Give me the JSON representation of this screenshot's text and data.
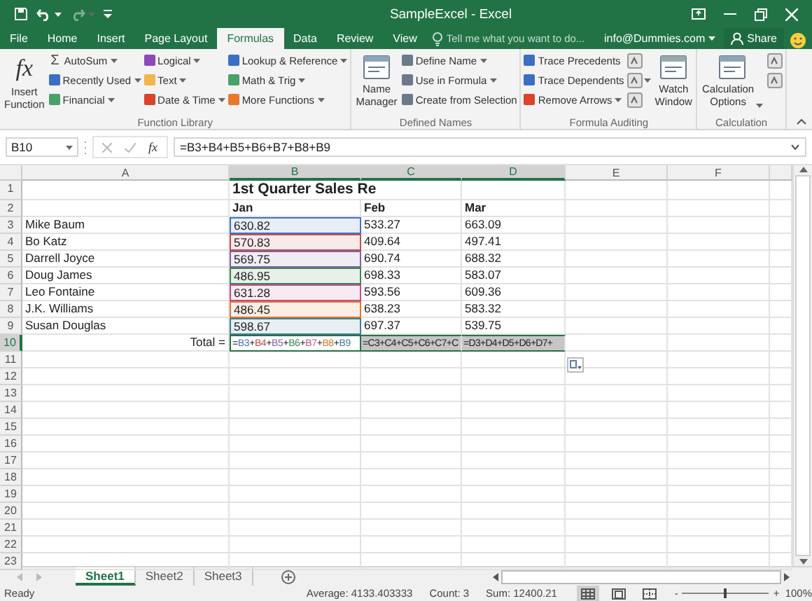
{
  "title_bar": {
    "title": "SampleExcel - Excel",
    "quick_access": [
      {
        "kind": "save",
        "disabled": false
      },
      {
        "kind": "undo",
        "disabled": false
      },
      {
        "kind": "redo",
        "disabled": true
      },
      {
        "kind": "customize",
        "disabled": false
      }
    ]
  },
  "ribbon_tabs": [
    {
      "label": "File",
      "selected": false
    },
    {
      "label": "Home",
      "selected": false
    },
    {
      "label": "Insert",
      "selected": false
    },
    {
      "label": "Page Layout",
      "selected": false
    },
    {
      "label": "Formulas",
      "selected": true
    },
    {
      "label": "Data",
      "selected": false
    },
    {
      "label": "Review",
      "selected": false
    },
    {
      "label": "View",
      "selected": false
    }
  ],
  "tell_me": {
    "placeholder": "Tell me what you want to do..."
  },
  "account": "info@Dummies.com",
  "share": "Share",
  "ribbon_groups": [
    {
      "label": "Function Library",
      "items": [
        {
          "kind": "large",
          "label": "Insert Function",
          "symbol": "fx",
          "dropdown": false
        },
        {
          "kind": "small",
          "label": "AutoSum",
          "symbol": "Σ",
          "dropdown": true
        },
        {
          "kind": "small",
          "label": "Recently Used",
          "color": "#3b6fc4",
          "dropdown": true
        },
        {
          "kind": "small",
          "label": "Financial",
          "color": "#4aa06a",
          "dropdown": true
        },
        {
          "kind": "small",
          "label": "Logical",
          "color": "#8a4bb8",
          "dropdown": true
        },
        {
          "kind": "small",
          "label": "Text",
          "color": "#f0b84a",
          "dropdown": true
        },
        {
          "kind": "small",
          "label": "Date & Time",
          "color": "#d9442a",
          "dropdown": true
        },
        {
          "kind": "small",
          "label": "Lookup & Reference",
          "color": "#3b6fc4",
          "dropdown": true
        },
        {
          "kind": "small",
          "label": "Math & Trig",
          "color": "#4aa06a",
          "dropdown": true
        },
        {
          "kind": "small",
          "label": "More Functions",
          "color": "#e8782a",
          "dropdown": true
        }
      ]
    },
    {
      "label": "Defined Names",
      "items": [
        {
          "kind": "large",
          "label": "Name Manager",
          "dropdown": false
        },
        {
          "kind": "small",
          "label": "Define Name",
          "color": "#6a7a8a",
          "dropdown": true
        },
        {
          "kind": "small",
          "label": "Use in Formula",
          "color": "#6a7a8a",
          "dropdown": true
        },
        {
          "kind": "small",
          "label": "Create from Selection",
          "color": "#6a7a8a",
          "dropdown": false
        }
      ]
    },
    {
      "label": "Formula Auditing",
      "items": [
        {
          "kind": "small",
          "label": "Trace Precedents",
          "color": "#3b6fc4",
          "dropdown": false
        },
        {
          "kind": "small",
          "label": "Trace Dependents",
          "color": "#3b6fc4",
          "dropdown": false
        },
        {
          "kind": "small",
          "label": "Remove Arrows",
          "color": "#d9442a",
          "dropdown": true
        },
        {
          "kind": "icon",
          "dropdown": false
        },
        {
          "kind": "icon",
          "dropdown": true
        },
        {
          "kind": "icon",
          "dropdown": false
        },
        {
          "kind": "large",
          "label": "Watch Window",
          "dropdown": false
        }
      ]
    },
    {
      "label": "Calculation",
      "items": [
        {
          "kind": "large",
          "label": "Calculation Options",
          "dropdown": true
        },
        {
          "kind": "icon",
          "dropdown": false
        },
        {
          "kind": "icon",
          "dropdown": false
        }
      ]
    }
  ],
  "formula_bar": {
    "name_box": "B10",
    "buttons": [
      {
        "kind": "cancel",
        "disabled": true
      },
      {
        "kind": "enter",
        "disabled": true
      },
      {
        "kind": "function",
        "symbol": "fx",
        "disabled": false
      }
    ],
    "formula": "=B3+B4+B5+B6+B7+B8+B9"
  },
  "columns": [
    {
      "label": "A",
      "selected": false
    },
    {
      "label": "B",
      "selected": true
    },
    {
      "label": "C",
      "selected": true
    },
    {
      "label": "D",
      "selected": true
    },
    {
      "label": "E",
      "selected": false
    },
    {
      "label": "F",
      "selected": false
    }
  ],
  "rows": [
    {
      "num": "1",
      "selected": false,
      "cells": [
        {
          "selected": false
        },
        {
          "kind": "title",
          "text": "1st Quarter Sales Re",
          "selected": false
        }
      ]
    },
    {
      "num": "2",
      "selected": false,
      "cells": [
        {
          "selected": false
        },
        {
          "kind": "header",
          "text": "Jan",
          "selected": false
        },
        {
          "kind": "header",
          "text": "Feb",
          "selected": false
        },
        {
          "kind": "header",
          "text": "Mar",
          "selected": false
        }
      ]
    },
    {
      "num": "3",
      "selected": false,
      "cells": [
        {
          "kind": "text",
          "text": "Mike Baum",
          "selected": false
        },
        {
          "kind": "text",
          "text": "630.82",
          "color": "#4472c4",
          "selected": false
        },
        {
          "kind": "text",
          "text": "533.27",
          "selected": false
        },
        {
          "kind": "text",
          "text": "663.09",
          "selected": false
        }
      ]
    },
    {
      "num": "4",
      "selected": false,
      "cells": [
        {
          "kind": "text",
          "text": "Bo Katz",
          "selected": false
        },
        {
          "kind": "text",
          "text": "570.83",
          "color": "#c0504d",
          "selected": false
        },
        {
          "kind": "text",
          "text": "409.64",
          "selected": false
        },
        {
          "kind": "text",
          "text": "497.41",
          "selected": false
        }
      ]
    },
    {
      "num": "5",
      "selected": false,
      "cells": [
        {
          "kind": "text",
          "text": "Darrell Joyce",
          "selected": false
        },
        {
          "kind": "text",
          "text": "569.75",
          "color": "#8064a2",
          "selected": false
        },
        {
          "kind": "text",
          "text": "690.74",
          "selected": false
        },
        {
          "kind": "text",
          "text": "688.32",
          "selected": false
        }
      ]
    },
    {
      "num": "6",
      "selected": false,
      "cells": [
        {
          "kind": "text",
          "text": "Doug James",
          "selected": false
        },
        {
          "kind": "text",
          "text": "486.95",
          "color": "#3a8a4f",
          "selected": false
        },
        {
          "kind": "text",
          "text": "698.33",
          "selected": false
        },
        {
          "kind": "text",
          "text": "583.07",
          "selected": false
        }
      ]
    },
    {
      "num": "7",
      "selected": false,
      "cells": [
        {
          "kind": "text",
          "text": "Leo Fontaine",
          "selected": false
        },
        {
          "kind": "text",
          "text": "631.28",
          "color": "#c04f8c",
          "selected": false
        },
        {
          "kind": "text",
          "text": "593.56",
          "selected": false
        },
        {
          "kind": "text",
          "text": "609.36",
          "selected": false
        }
      ]
    },
    {
      "num": "8",
      "selected": false,
      "cells": [
        {
          "kind": "text",
          "text": "J.K. Williams",
          "selected": false
        },
        {
          "kind": "text",
          "text": "486.45",
          "color": "#e0782c",
          "selected": false
        },
        {
          "kind": "text",
          "text": "638.23",
          "selected": false
        },
        {
          "kind": "text",
          "text": "583.32",
          "selected": false
        }
      ]
    },
    {
      "num": "9",
      "selected": false,
      "cells": [
        {
          "kind": "text",
          "text": "Susan Douglas",
          "selected": false
        },
        {
          "kind": "text",
          "text": "598.67",
          "color": "#3d7d9a",
          "selected": false
        },
        {
          "kind": "text",
          "text": "697.37",
          "selected": false
        },
        {
          "kind": "text",
          "text": "539.75",
          "selected": false
        }
      ]
    },
    {
      "num": "10",
      "selected": true,
      "cells": [
        {
          "kind": "total_label",
          "text": "Total =",
          "selected": false
        },
        {
          "kind": "editing",
          "selected": true,
          "parts": [
            {
              "text": "="
            },
            {
              "text": "B3",
              "color": "#4472c4"
            },
            {
              "text": "+"
            },
            {
              "text": "B4",
              "color": "#c0504d"
            },
            {
              "text": "+"
            },
            {
              "text": "B5",
              "color": "#8064a2"
            },
            {
              "text": "+"
            },
            {
              "text": "B6",
              "color": "#3a8a4f"
            },
            {
              "text": "+"
            },
            {
              "text": "B7",
              "color": "#c04f8c"
            },
            {
              "text": "+"
            },
            {
              "text": "B8",
              "color": "#e0782c"
            },
            {
              "text": "+"
            },
            {
              "text": "B9",
              "color": "#3d7d9a"
            }
          ]
        },
        {
          "kind": "formula",
          "text": "=C3+C4+C5+C6+C7+C",
          "selected": true
        },
        {
          "kind": "formula",
          "text": "=D3+D4+D5+D6+D7+",
          "selected": true
        }
      ]
    },
    {
      "num": "11",
      "selected": false
    },
    {
      "num": "12",
      "selected": false
    },
    {
      "num": "13",
      "selected": false
    },
    {
      "num": "14",
      "selected": false
    },
    {
      "num": "15",
      "selected": false
    },
    {
      "num": "16",
      "selected": false
    },
    {
      "num": "17",
      "selected": false
    },
    {
      "num": "18",
      "selected": false
    },
    {
      "num": "19",
      "selected": false
    },
    {
      "num": "20",
      "selected": false
    },
    {
      "num": "21",
      "selected": false
    },
    {
      "num": "22",
      "selected": false
    },
    {
      "num": "23",
      "selected": false
    }
  ],
  "sheet_tabs": [
    {
      "label": "Sheet1",
      "selected": true
    },
    {
      "label": "Sheet2",
      "selected": false
    },
    {
      "label": "Sheet3",
      "selected": false
    }
  ],
  "status_bar": {
    "ready": "Ready",
    "average": "Average: 4133.403333",
    "count": "Count: 3",
    "sum": "Sum: 12400.21",
    "views": [
      {
        "kind": "normal",
        "selected": true
      },
      {
        "kind": "page_layout",
        "selected": false
      },
      {
        "kind": "page_break",
        "selected": false
      }
    ],
    "zoom_minus": "-",
    "zoom_plus": "+",
    "zoom": {
      "level": 0.5
    },
    "zoom_percent": "100%"
  }
}
